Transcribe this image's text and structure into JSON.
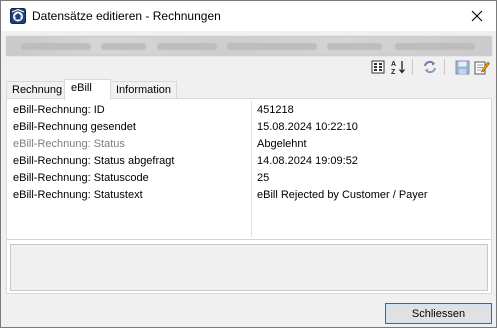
{
  "window": {
    "title": "Datensätze editieren - Rechnungen",
    "close_icon": "close-icon",
    "app_icon": "app-logo-icon"
  },
  "toolbar": {
    "icons": [
      "grid-select-icon",
      "sort-az-icon",
      "refresh-icon",
      "save-icon",
      "edit-icon"
    ]
  },
  "tabs": [
    {
      "label": "Rechnung",
      "active": false
    },
    {
      "label": "eBill",
      "active": true
    },
    {
      "label": "Information",
      "active": false
    }
  ],
  "rows": [
    {
      "label": "eBill-Rechnung: ID",
      "value": "451218",
      "dim": false
    },
    {
      "label": "eBill-Rechnung gesendet",
      "value": "15.08.2024 10:22:10",
      "dim": false
    },
    {
      "label": "eBill-Rechnung: Status",
      "value": "Abgelehnt",
      "dim": true
    },
    {
      "label": "eBill-Rechnung: Status abgefragt",
      "value": "14.08.2024 19:09:52",
      "dim": false
    },
    {
      "label": "eBill-Rechnung: Statuscode",
      "value": "25",
      "dim": false
    },
    {
      "label": "eBill-Rechnung: Statustext",
      "value": "eBill Rejected by Customer / Payer",
      "dim": false
    }
  ],
  "footer": {
    "close_label": "Schliessen"
  },
  "colors": {
    "accent": "#0078d7",
    "dim_text": "#7d7d7d"
  }
}
